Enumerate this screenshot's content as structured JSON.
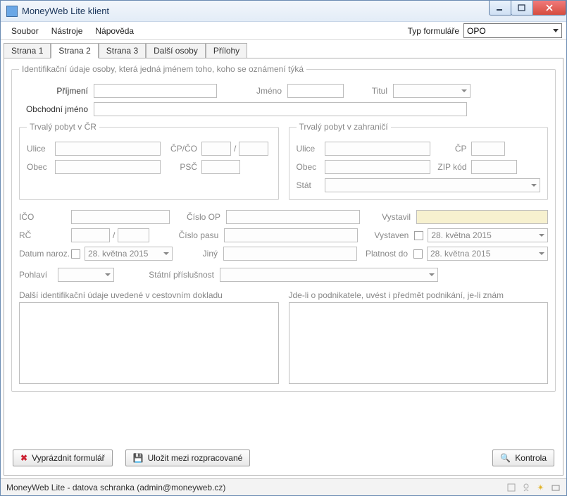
{
  "window": {
    "title": "MoneyWeb Lite klient"
  },
  "menu": {
    "file": "Soubor",
    "tools": "Nástroje",
    "help": "Nápověda",
    "form_type_label": "Typ formuláře",
    "form_type_value": "OPO"
  },
  "tabs": [
    "Strana 1",
    "Strana 2",
    "Strana 3",
    "Další osoby",
    "Přílohy"
  ],
  "active_tab": 1,
  "group_main_legend": "Identifikační údaje osoby, která jedná jménem toho, koho se oznámení týká",
  "labels": {
    "surname": "Příjmení",
    "firstname": "Jméno",
    "title": "Titul",
    "business_name": "Obchodní jméno",
    "perm_cz_legend": "Trvalý pobyt v ČR",
    "perm_abroad_legend": "Trvalý pobyt v zahraničí",
    "street": "Ulice",
    "cp_co": "ČP/ČO",
    "municipality": "Obec",
    "psc": "PSČ",
    "cp": "ČP",
    "zip": "ZIP kód",
    "state": "Stát",
    "ico": "IČO",
    "op": "Číslo OP",
    "issued_by": "Vystavil",
    "rc": "RČ",
    "passport": "Číslo pasu",
    "issued_on": "Vystaven",
    "dob": "Datum naroz.",
    "other": "Jiný",
    "valid_until": "Platnost do",
    "gender": "Pohlaví",
    "nationality": "Státní příslušnost",
    "other_id": "Další identifikační údaje uvedené v cestovním dokladu",
    "entrepreneur": "Jde-li o podnikatele, uvést i předmět podnikání, je-li znám"
  },
  "dates": {
    "dob": "28.  května  2015",
    "issued": "28.  května  2015",
    "valid": "28.  května  2015"
  },
  "buttons": {
    "clear": "Vyprázdnit formulář",
    "save_draft": "Uložit mezi rozpracované",
    "check": "Kontrola"
  },
  "status": {
    "text": "MoneyWeb Lite - datova schranka (admin@moneyweb.cz)"
  }
}
